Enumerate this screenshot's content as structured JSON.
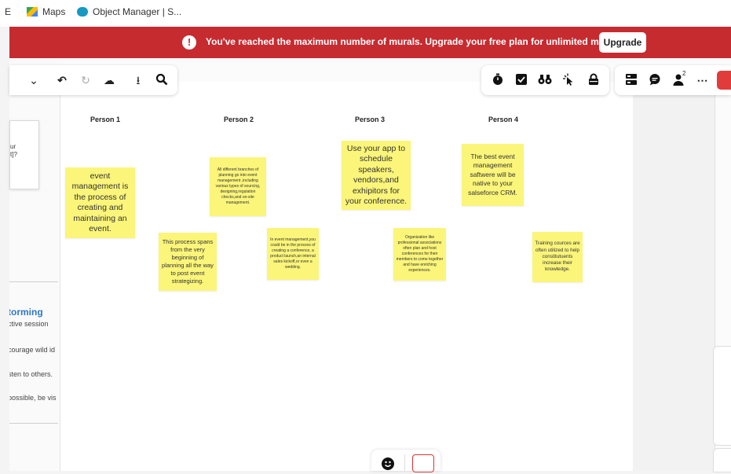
{
  "browser": {
    "bookmarks": [
      {
        "label": "E",
        "icon": "bookmark-icon"
      },
      {
        "label": "Maps",
        "icon": "maps-icon"
      },
      {
        "label": "Object Manager | S...",
        "icon": "salesforce-cloud-icon"
      }
    ]
  },
  "banner": {
    "message": "You've reached the maximum number of murals. Upgrade your free plan for unlimited murals.",
    "button": "Upgrade",
    "icon": "alert-icon",
    "color": "#c62b30"
  },
  "toolbar_left": {
    "icons": [
      "chevron-down-icon",
      "undo-icon",
      "redo-icon",
      "cloud-sync-icon",
      "download-icon",
      "search-icon"
    ]
  },
  "toolbar_right": {
    "icons": [
      "timer-icon",
      "check-square-icon",
      "binoculars-icon",
      "cursor-click-icon",
      "lock-icon"
    ]
  },
  "toolbar_far": {
    "icons": [
      "layout-icon",
      "comment-icon",
      "user-icon",
      "more-icon"
    ],
    "collaborators_count": "2"
  },
  "left_panel": {
    "card_lines": [
      "ur",
      "t]?"
    ],
    "title": "torming",
    "lines": [
      "ctive session",
      "courage wild id",
      "sten to others.",
      "possible, be vis"
    ]
  },
  "columns": [
    "Person 1",
    "Person 2",
    "Person 3",
    "Person 4"
  ],
  "stickies": {
    "p1a": "event management is the process of creating and maintaining an event.",
    "p1b": "This process spans from the very beginning of planning all the way to post event strategizing.",
    "p2a": "All different branches of planning go into event management ,including various types of sourcing, designing,regulation checks,and on-site management.",
    "p2b": "In event management,you could be in the process of creating a conference, a product launch,an internal sales kickoff,or even a wedding.",
    "p3a": "Use your app to schedule speakers, vendors,and exhipitors for your conference.",
    "p3b": "Organization like professional associations often plan and host conferences for their members to come together and have enriching experiences.",
    "p4a": "The best event management saftwere will be native to your salseforce CRM.",
    "p4b": "Training cources are often utilized to help constitutuents increase their knowledge."
  },
  "colors": {
    "sticky": "#fbf57a",
    "accent_blue": "#2f77c8"
  }
}
